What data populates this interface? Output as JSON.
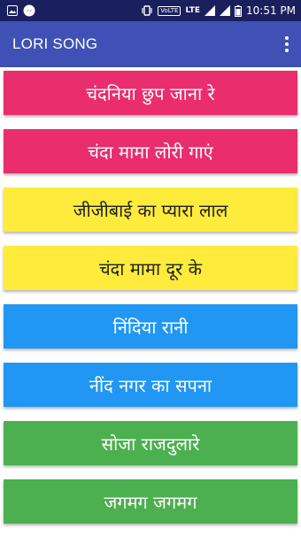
{
  "status_bar": {
    "volte": "VoLTE",
    "lte": "LTE",
    "time": "10:51 PM",
    "icons": [
      "photo-icon",
      "messenger-icon",
      "vibrate-icon",
      "volte-icon",
      "signal-icon",
      "signal-icon",
      "battery-icon"
    ]
  },
  "app_bar": {
    "title": "LORI SONG",
    "menu_icon": "overflow-menu-icon"
  },
  "colors": {
    "status_bar": "#1a1f5e",
    "app_bar": "#3f51b5",
    "pink": "#ea2d6c",
    "yellow": "#ffeb3b",
    "blue": "#2196f3",
    "green": "#4caf50"
  },
  "songs": [
    {
      "label": "चंदनिया छुप जाना रे",
      "color": "#ea2d6c",
      "text_color": "#ffffff"
    },
    {
      "label": "चंदा मामा लोरी गाएं",
      "color": "#ea2d6c",
      "text_color": "#ffffff"
    },
    {
      "label": "जीजीबाई का प्यारा लाल",
      "color": "#ffeb3b",
      "text_color": "#212121"
    },
    {
      "label": "चंदा मामा दूर के",
      "color": "#ffeb3b",
      "text_color": "#212121"
    },
    {
      "label": "निंदिया रानी",
      "color": "#2196f3",
      "text_color": "#ffffff"
    },
    {
      "label": "नींद नगर का सपना",
      "color": "#2196f3",
      "text_color": "#ffffff"
    },
    {
      "label": "सोजा राजदुलारे",
      "color": "#4caf50",
      "text_color": "#ffffff"
    },
    {
      "label": "जगमग जगमग",
      "color": "#4caf50",
      "text_color": "#ffffff"
    }
  ]
}
